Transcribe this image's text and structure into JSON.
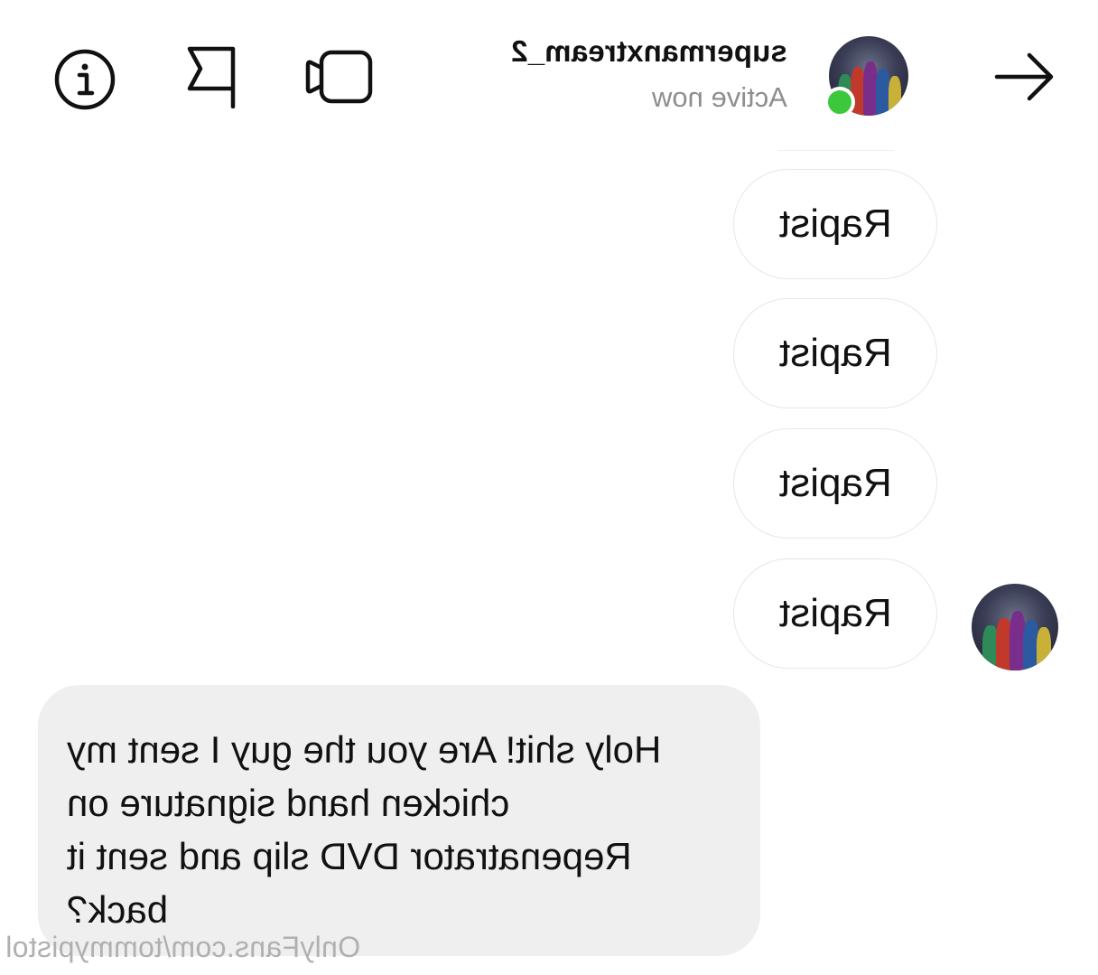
{
  "header": {
    "username": "supermanxtream_2",
    "status": "Active now",
    "icons": {
      "info": "info-icon",
      "flag": "flag-icon",
      "video": "video-call-icon",
      "back": "arrow-icon"
    }
  },
  "messages": {
    "incoming": [
      "Rapist",
      "Rapist",
      "Rapist",
      "Rapist"
    ],
    "outgoing": "Holy shit! Are you the guy I sent my chicken hand signature on Repenatrator DVD slip and sent it back?"
  },
  "watermark": "OnlyFans.com/tommypistol",
  "colors": {
    "online": "#3cc83c",
    "bubble": "#efefef",
    "status_text": "#8e8e8e"
  }
}
